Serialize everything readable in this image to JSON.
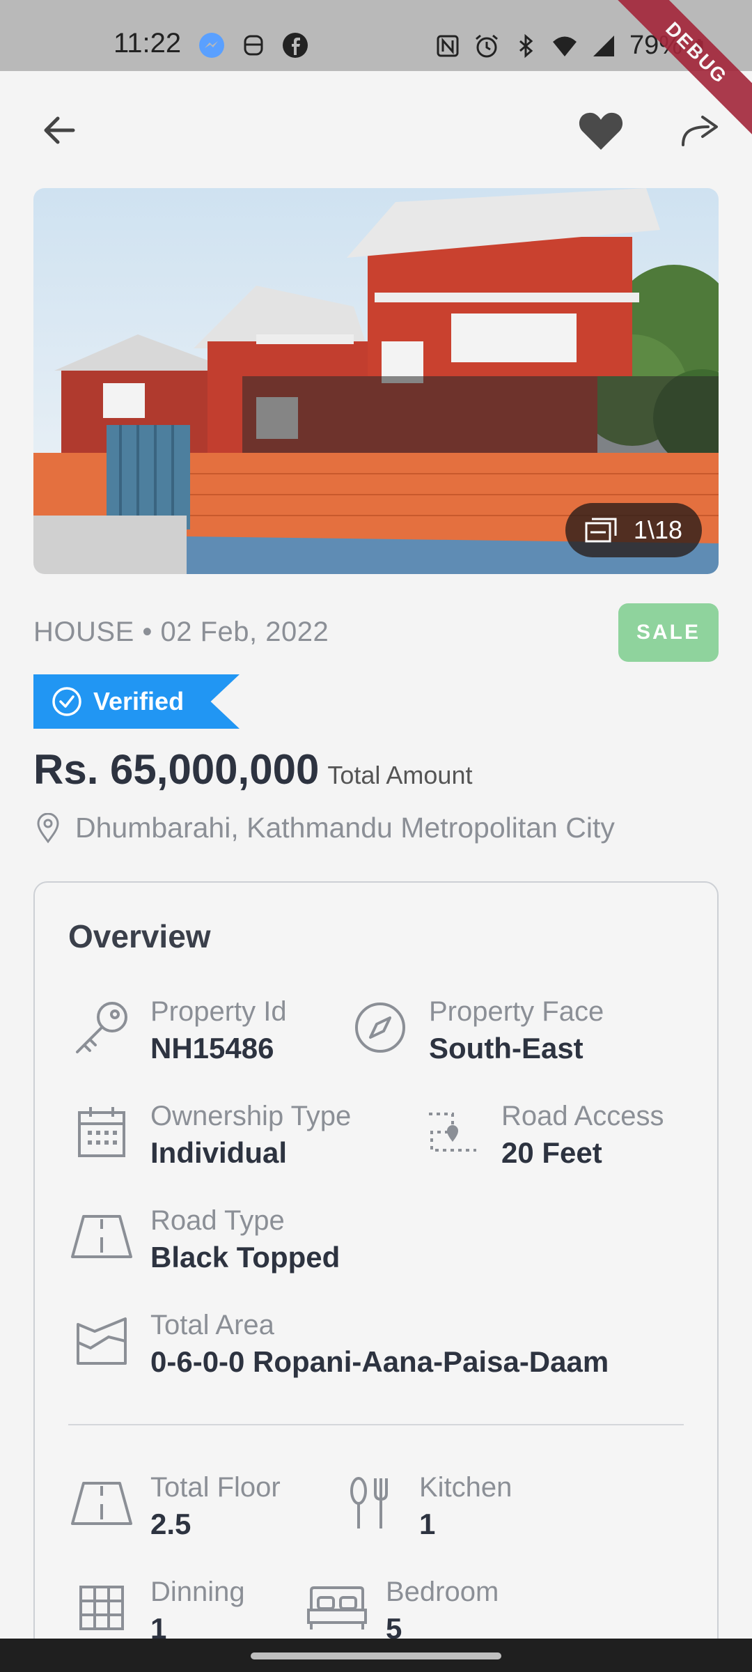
{
  "status_bar": {
    "time": "11:22",
    "battery": "79%",
    "debug_label": "DEBUG"
  },
  "top_bar": {
    "back_icon": "arrow-left-icon",
    "favorite_icon": "heart-icon",
    "share_icon": "share-arrow-icon"
  },
  "gallery": {
    "counter": "1\\18"
  },
  "listing": {
    "type": "HOUSE",
    "separator": "•",
    "date": "02 Feb, 2022",
    "status": "SALE",
    "status_color": "#8fd39d",
    "verified_label": "Verified",
    "verified_color": "#2196f3",
    "price": "Rs. 65,000,000",
    "price_note": "Total Amount",
    "location": "Dhumbarahi, Kathmandu Metropolitan City"
  },
  "overview": {
    "title": "Overview",
    "property_id": {
      "label": "Property Id",
      "value": "NH15486",
      "icon": "key-icon"
    },
    "property_face": {
      "label": "Property Face",
      "value": "South-East",
      "icon": "compass-icon"
    },
    "ownership_type": {
      "label": "Ownership Type",
      "value": "Individual",
      "icon": "calendar-icon"
    },
    "road_access": {
      "label": "Road Access",
      "value": "20 Feet",
      "icon": "route-icon"
    },
    "road_type": {
      "label": "Road Type",
      "value": "Black Topped",
      "icon": "road-icon"
    },
    "total_area": {
      "label": "Total Area",
      "value": "0-6-0-0 Ropani-Aana-Paisa-Daam",
      "icon": "area-icon"
    },
    "total_floor": {
      "label": "Total Floor",
      "value": "2.5",
      "icon": "road-icon"
    },
    "kitchen": {
      "label": "Kitchen",
      "value": "1",
      "icon": "utensils-icon"
    },
    "dinning": {
      "label": "Dinning",
      "value": "1",
      "icon": "grid-icon"
    },
    "bedroom": {
      "label": "Bedroom",
      "value": "5",
      "icon": "bed-icon"
    }
  }
}
